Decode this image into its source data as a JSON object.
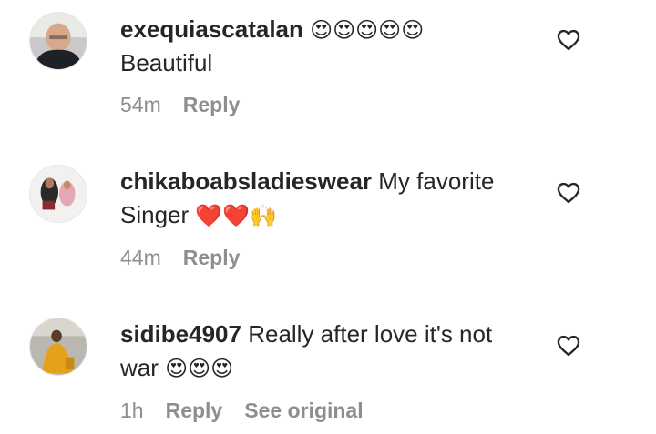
{
  "comments": [
    {
      "username": "exequiascatalan",
      "text": "",
      "emojis": "😍😍😍😍😍",
      "second_line": "Beautiful",
      "second_emojis": "",
      "time": "54m",
      "reply_label": "Reply",
      "extra_label": "",
      "avatar_icon": "user-avatar-photo"
    },
    {
      "username": "chikaboabsladieswear",
      "text": " My favorite",
      "emojis": "",
      "second_line": "Singer ",
      "second_emojis": "❤️❤️🙌",
      "time": "44m",
      "reply_label": "Reply",
      "extra_label": "",
      "avatar_icon": "user-avatar-photo"
    },
    {
      "username": "sidibe4907",
      "text": " Really after love it's not",
      "emojis": "",
      "second_line": "war ",
      "second_emojis": "😍😍😍",
      "time": "1h",
      "reply_label": "Reply",
      "extra_label": "See original",
      "avatar_icon": "user-avatar-photo"
    }
  ],
  "colors": {
    "text": "#262626",
    "muted": "#8e8e8e",
    "background": "#ffffff"
  }
}
